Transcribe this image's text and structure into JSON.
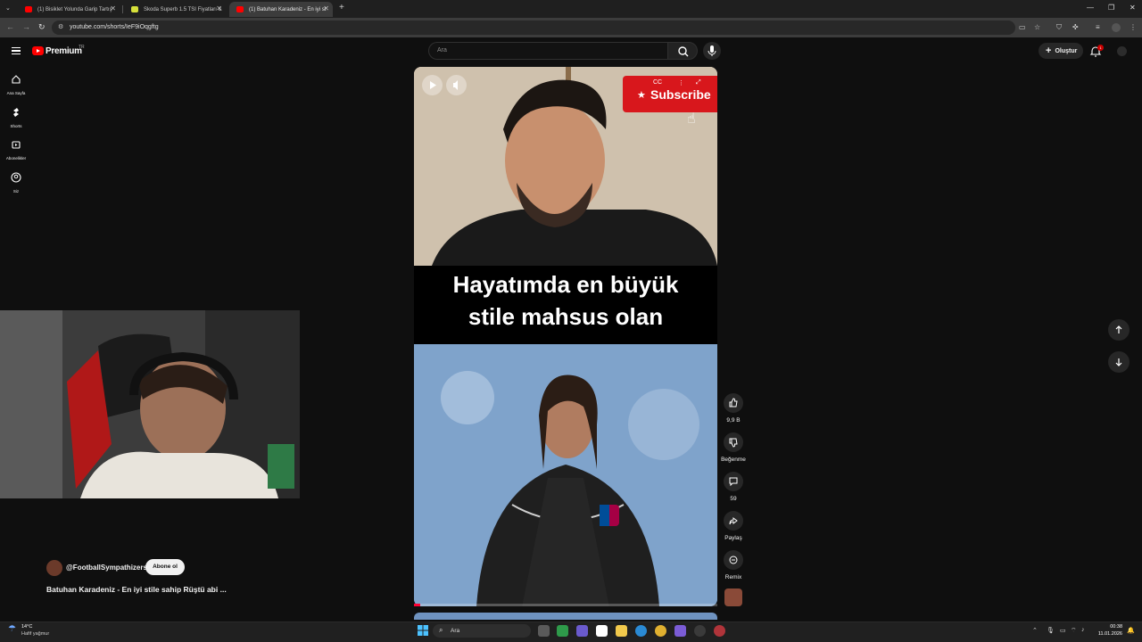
{
  "browser": {
    "tabs": [
      {
        "title": "(1) Bisiklet Yolunda Garip Tartış",
        "favicon": "youtube-icon",
        "active": false
      },
      {
        "title": "Skoda Superb 1.5 TSI Fiyatları &",
        "favicon": "skoda-icon",
        "active": false
      },
      {
        "title": "(1) Batuhan Karadeniz - En iyi st",
        "favicon": "youtube-icon",
        "active": true
      }
    ],
    "new_tab": "+",
    "url": "youtube.com/shorts/IeF9iOqgftg"
  },
  "header": {
    "logo_text": "Premium",
    "region": "TR",
    "search_placeholder": "Ara",
    "create_label": "Oluştur",
    "notification_count": "1"
  },
  "sidebar": {
    "items": [
      {
        "label": "Ana Sayfa",
        "icon": "home-icon"
      },
      {
        "label": "Shorts",
        "icon": "shorts-icon"
      },
      {
        "label": "Abonelikler",
        "icon": "subscriptions-icon"
      },
      {
        "label": "Siz",
        "icon": "you-icon"
      }
    ]
  },
  "video": {
    "caption_line1": "Hayatımda en büyük",
    "caption_line2": "stile mahsus olan",
    "subscribe_overlay": "Subscribe",
    "progress": 0.02
  },
  "channel": {
    "handle": "@FootballSympathizers",
    "subscribe_label": "Abone ol",
    "title": "Batuhan Karadeniz - En iyi stile sahip Rüştü abi ..."
  },
  "actions": {
    "likes": "9,9 B",
    "dislike_label": "Beğenme",
    "comments": "59",
    "share_label": "Paylaş",
    "remix_label": "Remix"
  },
  "taskbar": {
    "temperature": "14°C",
    "weather": "Hafif yağmur",
    "search_label": "Ara",
    "time": "00:38",
    "date": "11.01.2026"
  },
  "colors": {
    "accent": "#ff0000",
    "subscribe_red": "#d8171c"
  }
}
